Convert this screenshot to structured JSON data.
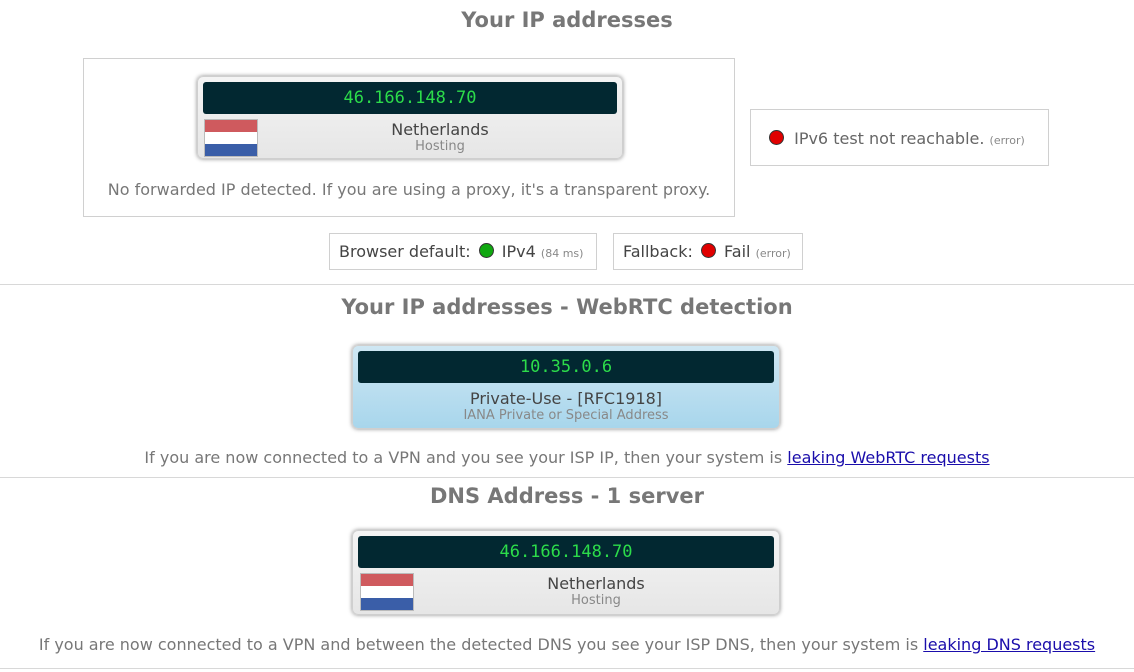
{
  "section1": {
    "heading": "Your IP addresses",
    "ip_card": {
      "ip": "46.166.148.70",
      "country": "Netherlands",
      "type": "Hosting",
      "flag_colors": [
        "#cf5a5e",
        "#ffffff",
        "#3a5ea8"
      ]
    },
    "forward_note": "No forwarded IP detected. If you are using a proxy, it's a transparent proxy.",
    "ipv6": {
      "status_color": "#e00000",
      "text": "IPv6 test not reachable.",
      "detail": "(error)"
    },
    "browser_default": {
      "label": "Browser default:",
      "status_color": "#11a811",
      "value": "IPv4",
      "detail": "(84 ms)"
    },
    "fallback": {
      "label": "Fallback:",
      "status_color": "#e00000",
      "value": "Fail",
      "detail": "(error)"
    }
  },
  "section2": {
    "heading": "Your IP addresses - WebRTC detection",
    "ip_card": {
      "ip": "10.35.0.6",
      "name": "Private-Use - [RFC1918]",
      "sub": "IANA Private or Special Address"
    },
    "note_prefix": "If you are now connected to a VPN and you see your ISP IP, then your system is ",
    "note_link": "leaking WebRTC requests"
  },
  "section3": {
    "heading": "DNS Address - 1 server",
    "ip_card": {
      "ip": "46.166.148.70",
      "country": "Netherlands",
      "type": "Hosting",
      "flag_colors": [
        "#cf5a5e",
        "#ffffff",
        "#3a5ea8"
      ]
    },
    "note_prefix": "If you are now connected to a VPN and between the detected DNS you see your ISP DNS, then your system is ",
    "note_link": "leaking DNS requests"
  }
}
